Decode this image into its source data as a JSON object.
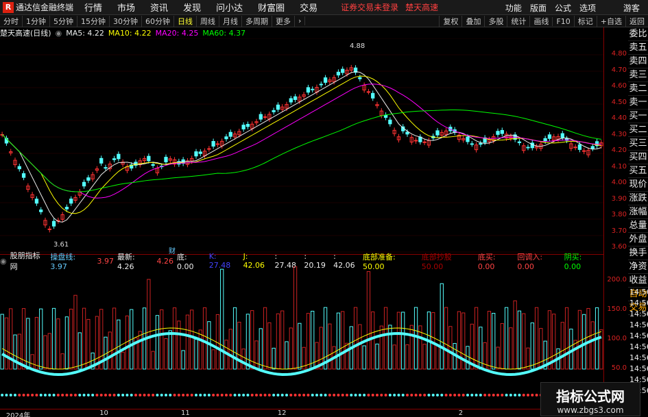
{
  "app": {
    "logo": "R",
    "title": "通达信金融终端",
    "menus": [
      "行情",
      "市场",
      "资讯",
      "发现",
      "问小达",
      "财富圈",
      "交易"
    ],
    "warning": "证券交易未登录",
    "stock_title": "楚天高速",
    "right_menus": [
      "功能",
      "版面",
      "公式",
      "选项"
    ],
    "guest": "游客"
  },
  "toolbar": {
    "periods": [
      "分时",
      "1分钟",
      "5分钟",
      "15分钟",
      "30分钟",
      "60分钟",
      "日线",
      "周线",
      "月线",
      "多周期",
      "更多"
    ],
    "active": "日线",
    "more_icon": "chevron-right",
    "right_tools": [
      "复权",
      "叠加",
      "多股",
      "统计",
      "画线",
      "F10",
      "标记",
      "+自选",
      "返回"
    ]
  },
  "info": {
    "stock": "楚天高速(日线)",
    "ma5": "MA5: 4.22",
    "ma10": "MA10: 4.22",
    "ma20": "MA20: 4.25",
    "ma60": "MA60: 4.37"
  },
  "price_labels": {
    "high": "4.88",
    "low": "3.61",
    "event": "财"
  },
  "yaxis_price": [
    "4.80",
    "4.70",
    "4.60",
    "4.50",
    "4.40",
    "4.30",
    "4.20",
    "4.10",
    "4.00",
    "3.90",
    "3.80",
    "3.70",
    "3.60"
  ],
  "yaxis_sub": [
    "200.0",
    "150.0",
    "100.0",
    "50.0"
  ],
  "sub": {
    "name": "股朋指标网",
    "fields": [
      {
        "label": "操盘线:",
        "value": "3.97",
        "color": "#6cf"
      },
      {
        "label": "",
        "value": "3.97",
        "color": "#f44"
      },
      {
        "label": "最新:",
        "value": "4.26",
        "color": "#eee"
      },
      {
        "label": "",
        "value": "4.26",
        "color": "#f44"
      },
      {
        "label": "底:",
        "value": "0.00",
        "color": "#eee"
      },
      {
        "label": "K:",
        "value": "27.48",
        "color": "#44f"
      },
      {
        "label": "J:",
        "value": "42.06",
        "color": "#ff0"
      },
      {
        "label": ":",
        "value": "27.48",
        "color": "#eee"
      },
      {
        "label": ":",
        "value": "20.19",
        "color": "#eee"
      },
      {
        "label": ":",
        "value": "42.06",
        "color": "#eee"
      },
      {
        "label": "底部准备:",
        "value": "50.00",
        "color": "#ff0"
      },
      {
        "label": "底部抄股",
        "value": "50.00",
        "color": "#a00"
      },
      {
        "label": "底买:",
        "value": "0.00",
        "color": "#f44"
      },
      {
        "label": "回调入:",
        "value": "0.00",
        "color": "#f44"
      },
      {
        "label": "阴买:",
        "value": "0.00",
        "color": "#0f0"
      }
    ]
  },
  "xaxis": [
    {
      "label": "2024年",
      "pos": 0.01
    },
    {
      "label": "10",
      "pos": 0.165
    },
    {
      "label": "11",
      "pos": 0.3
    },
    {
      "label": "12",
      "pos": 0.46
    },
    {
      "label": "2",
      "pos": 0.76
    }
  ],
  "right_panel": [
    "委比",
    "卖五",
    "卖四",
    "卖三",
    "卖二",
    "卖一",
    "买一",
    "买二",
    "买三",
    "买四",
    "买五",
    "现价",
    "涨跌",
    "涨幅",
    "总量",
    "外盘",
    "换手",
    "净资",
    "收益",
    "自动",
    "交易"
  ],
  "time_list": [
    "14:56",
    "14:56",
    "14:56",
    "14:56",
    "14:56",
    "14:56",
    "14:56",
    "14:56",
    "14:56",
    "14:56"
  ],
  "watermark": {
    "title": "指标公式网",
    "url": "www.zbgs3.com"
  }
}
